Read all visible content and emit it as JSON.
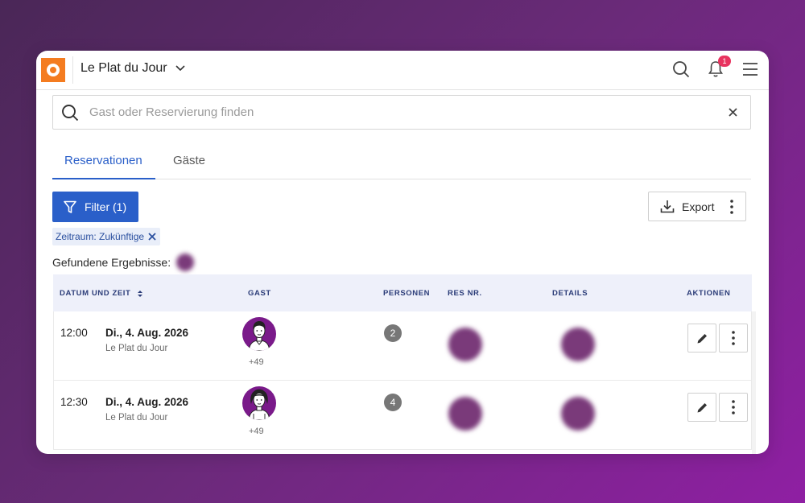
{
  "header": {
    "venue_name": "Le Plat du Jour",
    "notification_count": "1"
  },
  "search": {
    "placeholder": "Gast oder Reservierung finden",
    "value": ""
  },
  "tabs": [
    {
      "label": "Reservationen",
      "active": true
    },
    {
      "label": "Gäste",
      "active": false
    }
  ],
  "toolbar": {
    "filter_label": "Filter (1)",
    "export_label": "Export"
  },
  "active_filter": {
    "label": "Zeitraum: Zukünftige"
  },
  "results": {
    "label": "Gefundene Ergebnisse:"
  },
  "table": {
    "columns": [
      "DATUM UND ZEIT",
      "GAST",
      "PERSONEN",
      "RES NR.",
      "DETAILS",
      "AKTIONEN"
    ],
    "rows": [
      {
        "time": "12:00",
        "date": "Di., 4. Aug. 2026",
        "venue": "Le Plat du Jour",
        "phone": "+49",
        "persons": "2"
      },
      {
        "time": "12:30",
        "date": "Di., 4. Aug. 2026",
        "venue": "Le Plat du Jour",
        "phone": "+49",
        "persons": "4"
      }
    ]
  },
  "colors": {
    "accent": "#2a5fc9",
    "brand_orange": "#f47c20",
    "badge": "#e8335f",
    "avatar_bg": "#7a1a8a",
    "background_gradient_start": "#4a2757",
    "background_gradient_end": "#8f1fa3"
  }
}
